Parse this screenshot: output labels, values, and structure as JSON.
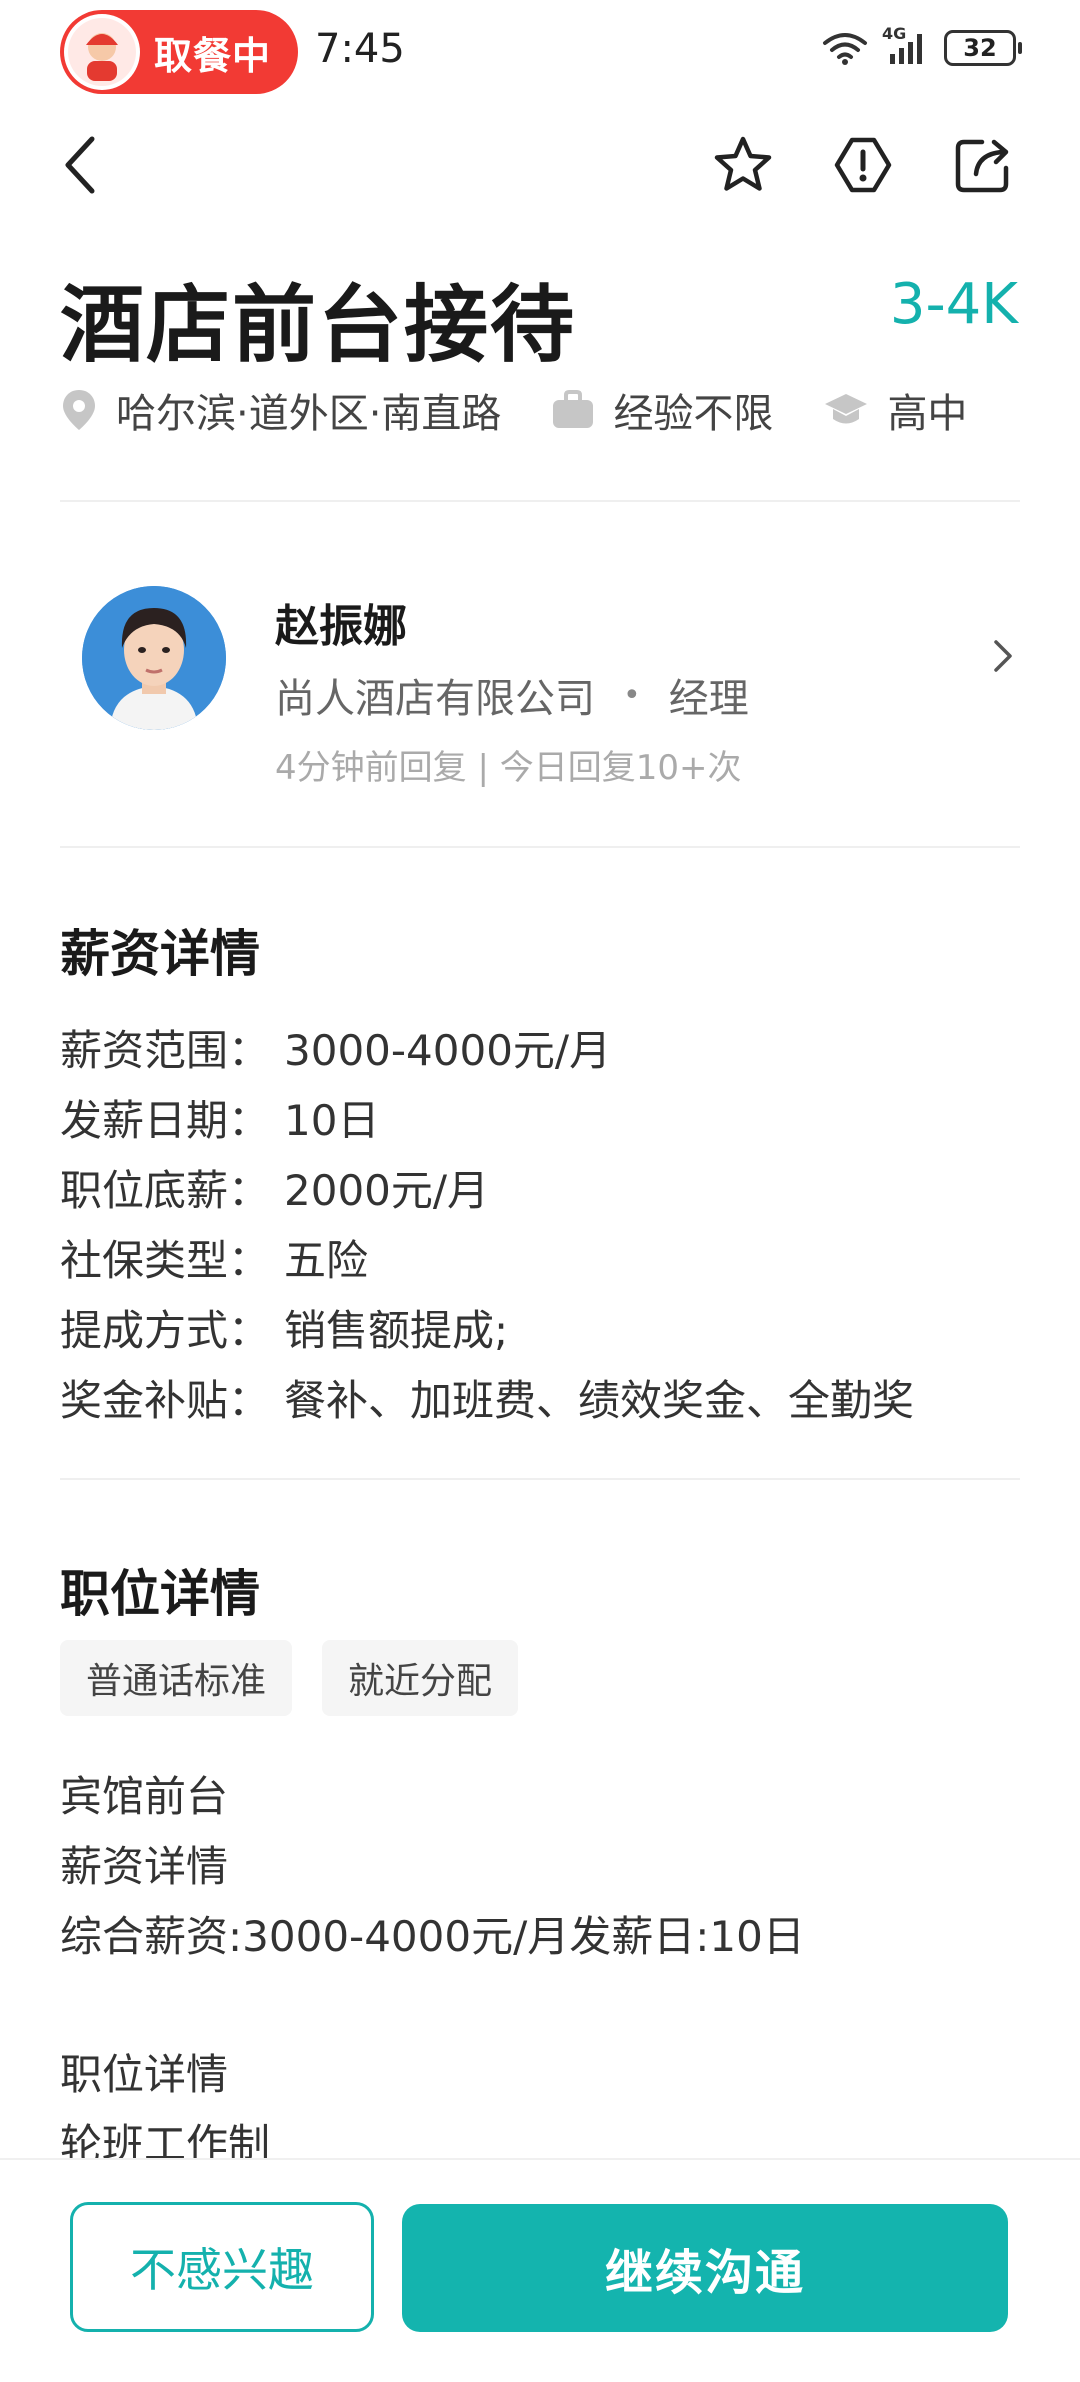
{
  "status_bar": {
    "pill_label": "取餐中",
    "time": "7:45",
    "network": "4G",
    "battery": "32"
  },
  "job": {
    "title": "酒店前台接待",
    "salary": "3-4K",
    "location": "哈尔滨·道外区·南直路",
    "experience": "经验不限",
    "education": "高中"
  },
  "recruiter": {
    "name": "赵振娜",
    "company": "尚人酒店有限公司",
    "separator": "•",
    "position": "经理",
    "activity": "4分钟前回复 | 今日回复10+次"
  },
  "salary_details": {
    "title": "薪资详情",
    "rows": [
      {
        "key": "薪资范围：",
        "value": "3000-4000元/月"
      },
      {
        "key": "发薪日期：",
        "value": "10日"
      },
      {
        "key": "职位底薪：",
        "value": "2000元/月"
      },
      {
        "key": "社保类型：",
        "value": "五险"
      },
      {
        "key": "提成方式：",
        "value": "销售额提成;"
      },
      {
        "key": "奖金补贴：",
        "value": "餐补、加班费、绩效奖金、全勤奖"
      }
    ]
  },
  "job_details": {
    "title": "职位详情",
    "tags": [
      "普通话标准",
      "就近分配"
    ],
    "lines": [
      "宾馆前台",
      "薪资详情",
      "综合薪资:3000-4000元/月发薪日:10日",
      "",
      "职位详情",
      "轮班工作制"
    ]
  },
  "actions": {
    "not_interested": "不感兴趣",
    "continue_chat": "继续沟通"
  },
  "colors": {
    "accent": "#14b1ad",
    "pill": "#f23a34"
  },
  "icons": [
    "back-icon",
    "star-icon",
    "report-icon",
    "share-icon",
    "location-icon",
    "briefcase-icon",
    "graduation-cap-icon",
    "chevron-right-icon"
  ]
}
